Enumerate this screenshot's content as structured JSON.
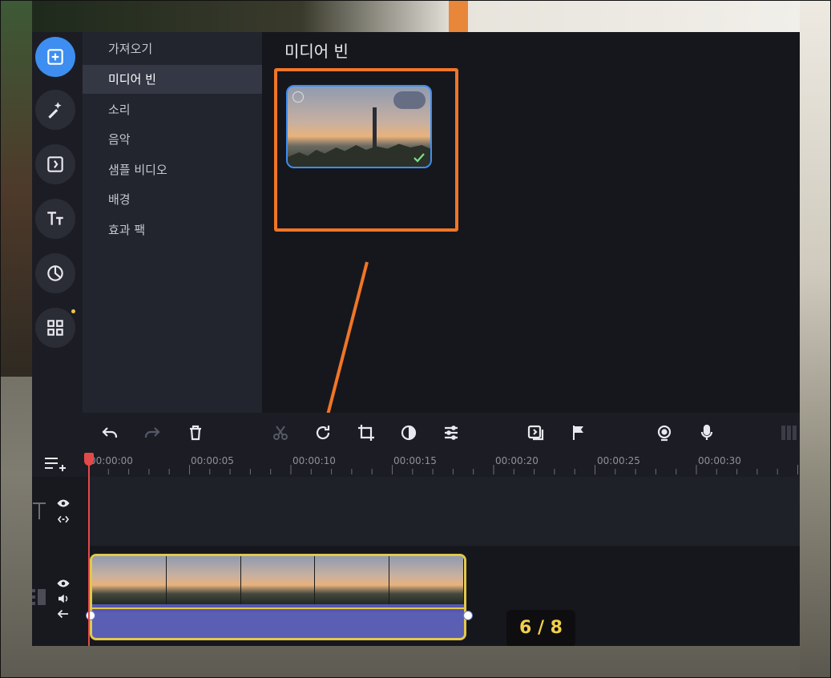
{
  "sidebar": {
    "categories": [
      {
        "label": "가져오기"
      },
      {
        "label": "미디어 빈"
      },
      {
        "label": "소리"
      },
      {
        "label": "음악"
      },
      {
        "label": "샘플 비디오"
      },
      {
        "label": "배경"
      },
      {
        "label": "효과 팩"
      }
    ],
    "active_index": 1
  },
  "media_bin": {
    "title": "미디어 빈",
    "items": [
      {
        "type": "video",
        "selected": true
      }
    ]
  },
  "timeline": {
    "ruler_labels": [
      "00:00:00",
      "00:00:05",
      "00:00:10",
      "00:00:15",
      "00:00:20",
      "00:00:25",
      "00:00:30"
    ]
  },
  "overlay": {
    "step_counter": "6 / 8",
    "highlight_color": "#f07628",
    "arrow_color": "#f07628"
  },
  "colors": {
    "accent": "#3d8ef0",
    "clip_border": "#e3c84a",
    "playhead": "#e24a4a"
  }
}
